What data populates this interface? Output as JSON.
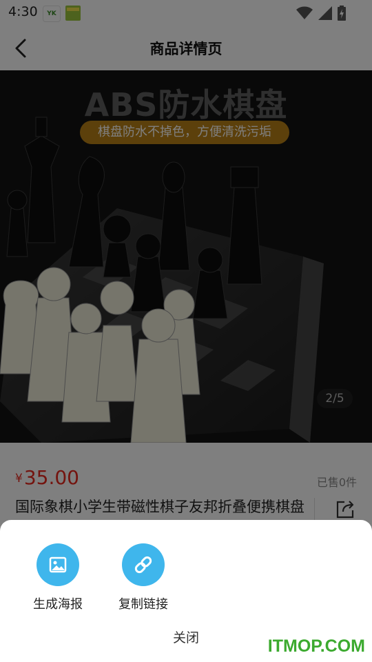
{
  "status_bar": {
    "time": "4:30",
    "app_icon_1_text": "YK",
    "icons": [
      "wifi-icon",
      "cell-signal-icon",
      "battery-charging-icon"
    ]
  },
  "header": {
    "title": "商品详情页",
    "back_icon": "chevron-left-icon"
  },
  "gallery": {
    "banner_title": "ABS防水棋盘",
    "banner_subtitle": "棋盘防水不掉色，方便清洗污垢",
    "pager": "2/5"
  },
  "product": {
    "currency": "¥",
    "price": "35.00",
    "sold": "已售0件",
    "name": "国际象棋小学生带磁性棋子友邦折叠便携棋盘高端比赛儿童专用高档",
    "share_icon": "share-icon"
  },
  "share_sheet": {
    "options": [
      {
        "label": "生成海报",
        "icon": "image-icon"
      },
      {
        "label": "复制链接",
        "icon": "link-icon"
      }
    ],
    "close_label": "关闭",
    "accent": "#3fb6ec"
  },
  "watermark": "ITMOP.COM",
  "colors": {
    "price": "#e8291e",
    "watermark": "#3caa2f"
  }
}
